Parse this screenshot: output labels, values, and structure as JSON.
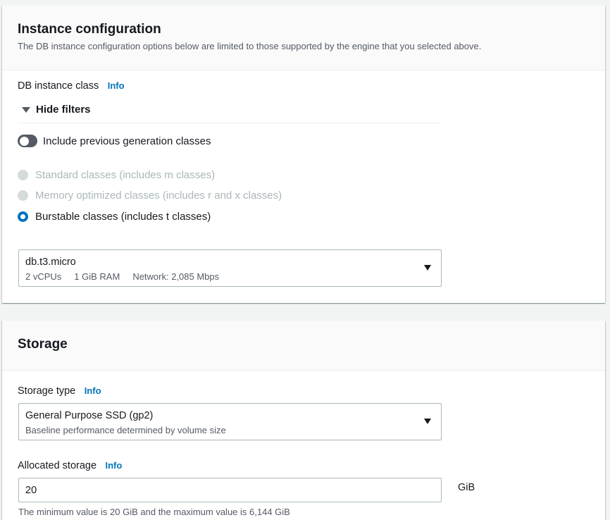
{
  "instance_config": {
    "title": "Instance configuration",
    "description": "The DB instance configuration options below are limited to those supported by the engine that you selected above.",
    "db_class_label": "DB instance class",
    "info_link": "Info",
    "hide_filters": "Hide filters",
    "include_previous_label": "Include previous generation classes",
    "include_previous_enabled": false,
    "class_options": [
      {
        "label": "Standard classes (includes m classes)",
        "state": "disabled"
      },
      {
        "label": "Memory optimized classes (includes r and x classes)",
        "state": "disabled"
      },
      {
        "label": "Burstable classes (includes t classes)",
        "state": "selected"
      }
    ],
    "selected_instance": {
      "name": "db.t3.micro",
      "vcpus": "2 vCPUs",
      "ram": "1 GiB RAM",
      "network": "Network: 2,085 Mbps"
    }
  },
  "storage": {
    "title": "Storage",
    "type_label": "Storage type",
    "info_link": "Info",
    "selected_type": {
      "name": "General Purpose SSD (gp2)",
      "description": "Baseline performance determined by volume size"
    },
    "allocated_label": "Allocated storage",
    "allocated_info_link": "Info",
    "allocated_value": "20",
    "unit": "GiB",
    "hint": "The minimum value is 20 GiB and the maximum value is 6,144 GiB"
  },
  "colors": {
    "accent": "#0073bb",
    "toggle_off": "#545b64",
    "disabled": "#aab7b8"
  }
}
